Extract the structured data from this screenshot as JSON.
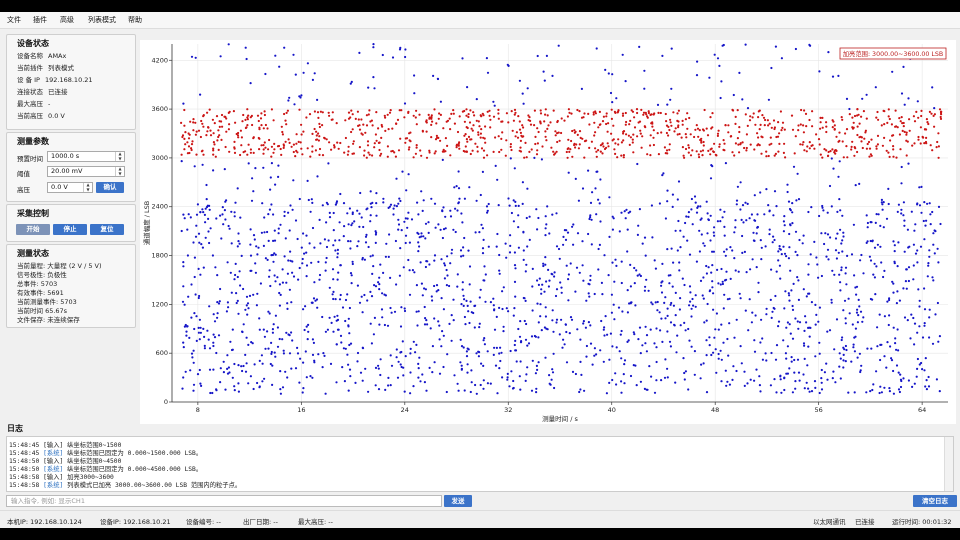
{
  "menu": [
    "文件",
    "插件",
    "高级",
    "列表模式",
    "帮助"
  ],
  "device_status": {
    "title": "设备状态",
    "rows": [
      {
        "key": "设备名称",
        "value": "AMAx"
      },
      {
        "key": "当前插件",
        "value": "列表模式"
      },
      {
        "key": "设 备 IP",
        "value": "192.168.10.21"
      },
      {
        "key": "连接状态",
        "value": "已连接"
      },
      {
        "key": "最大高压",
        "value": "-"
      },
      {
        "key": "当前高压",
        "value": "0.0 V"
      }
    ]
  },
  "measure_params": {
    "title": "测量参数",
    "preset_label": "预置时间",
    "preset_value": "1000.0 s",
    "threshold_label": "阈值",
    "threshold_value": "20.00 mV",
    "hv_label": "高压",
    "hv_value": "0.0 V",
    "confirm_label": "确认"
  },
  "acq_control": {
    "title": "采集控制",
    "start_label": "开始",
    "stop_label": "停止",
    "reset_label": "复位"
  },
  "measure_status": {
    "title": "测量状态",
    "lines": [
      "当前量程: 大量程 (2 V / 5 V)",
      "信号极性: 负极性",
      "总事件: 5703",
      "有效事件: 5691",
      "当前测量事件: 5703",
      "当前时间 65.67s",
      "文件保存: 未连续保存"
    ]
  },
  "chart_data": {
    "type": "scatter",
    "xlabel": "测量时间 / s",
    "ylabel": "通道幅度 / LSB",
    "xlim": [
      6,
      66
    ],
    "ylim": [
      0,
      4400
    ],
    "xticks": [
      8,
      16,
      24,
      32,
      40,
      48,
      56,
      64
    ],
    "yticks": [
      0,
      600,
      1200,
      1800,
      2400,
      3000,
      3600,
      4200
    ],
    "annotation": "加亮范围: 3000.00~3600.00 LSB",
    "series": [
      {
        "name": "",
        "color": "#1515c8",
        "y_range": [
          100,
          4400
        ],
        "density_note": ""
      },
      {
        "name": "",
        "color": "#cc1515",
        "y_range": [
          3000,
          3600
        ]
      }
    ]
  },
  "log": {
    "title": "日志",
    "lines": [
      {
        "time": "15:48:45",
        "tag": "[输入]",
        "text": "纵坐标范围0~1500",
        "tag_color": "#222222"
      },
      {
        "time": "15:48:45",
        "tag": "[系统]",
        "text": "纵坐标范围已固定为 0.000~1500.000 LSB。",
        "tag_color": "#2a6fbf"
      },
      {
        "time": "15:48:50",
        "tag": "[输入]",
        "text": "纵坐标范围0~4500",
        "tag_color": "#222222"
      },
      {
        "time": "15:48:50",
        "tag": "[系统]",
        "text": "纵坐标范围已固定为 0.000~4500.000 LSB。",
        "tag_color": "#2a6fbf"
      },
      {
        "time": "15:48:58",
        "tag": "[输入]",
        "text": "加亮3000~3600",
        "tag_color": "#222222"
      },
      {
        "time": "15:48:58",
        "tag": "[系统]",
        "text": "列表模式已加亮 3000.00~3600.00 LSB 范围内的粒子点。",
        "tag_color": "#2a6fbf"
      }
    ]
  },
  "command": {
    "placeholder": "输入指令, 例如: 显示CH1",
    "send_label": "发送",
    "clear_label": "清空日志"
  },
  "statusbar": {
    "local_ip": "本机IP: 192.168.10.124",
    "device_ip": "设备IP: 192.168.10.21",
    "device_no": "设备编号: --",
    "mfg_date": "出厂日期: --",
    "max_hv": "最大高压: --",
    "link": "以太网通讯",
    "conn": "已连接",
    "runtime": "运行时间: 00:01:32"
  }
}
